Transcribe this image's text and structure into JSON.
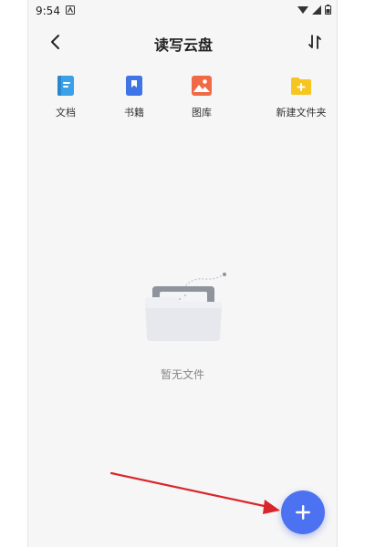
{
  "status_bar": {
    "time": "9:54"
  },
  "header": {
    "title": "读写云盘"
  },
  "shortcuts": [
    {
      "label": "文档",
      "icon": "document-icon",
      "color": "#3aa0e8"
    },
    {
      "label": "书籍",
      "icon": "book-icon",
      "color": "#3f74e6"
    },
    {
      "label": "图库",
      "icon": "gallery-icon",
      "color": "#f06a45"
    },
    {
      "label": "新建文件夹",
      "icon": "new-folder-icon",
      "color": "#f7c521"
    }
  ],
  "empty_state": {
    "message": "暂无文件"
  },
  "fab": {
    "icon": "plus-icon",
    "color": "#4c72f2"
  },
  "annotation": {
    "color": "#d9262b"
  }
}
